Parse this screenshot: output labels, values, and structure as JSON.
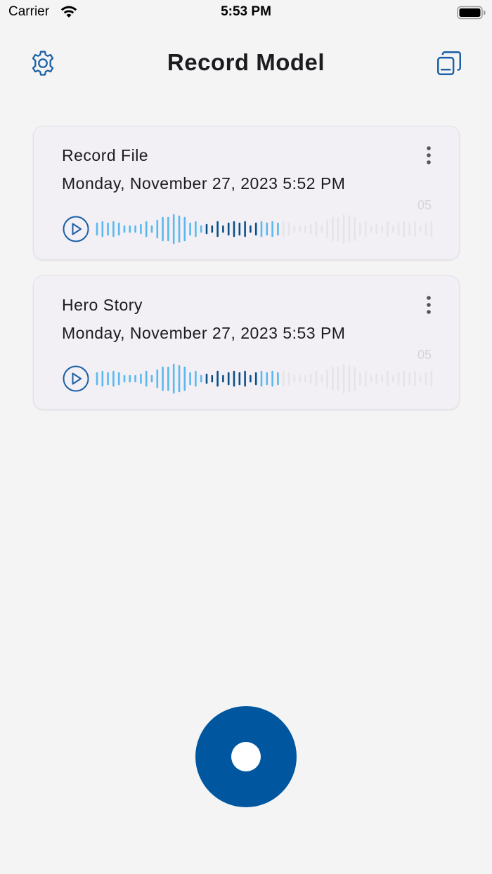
{
  "status_bar": {
    "carrier": "Carrier",
    "time": "5:53 PM",
    "icons": [
      "wifi-icon",
      "battery-icon"
    ]
  },
  "app_bar": {
    "title": "Record Model",
    "left_icon": "gear-icon",
    "right_icon": "copy-icon"
  },
  "recordings": [
    {
      "title": "Record File",
      "date": "Monday, November 27, 2023 5:52 PM",
      "duration": "05"
    },
    {
      "title": "Hero Story",
      "date": "Monday, November 27, 2023 5:53 PM",
      "duration": "05"
    }
  ],
  "colors": {
    "accent": "#00579f",
    "wave_played_light": "#5ab8ef",
    "wave_played_dark": "#0c4f86",
    "wave_unplayed": "#e6e4e8",
    "card_bg": "#f2eff5"
  },
  "record_button": {
    "icon": "record-icon"
  }
}
